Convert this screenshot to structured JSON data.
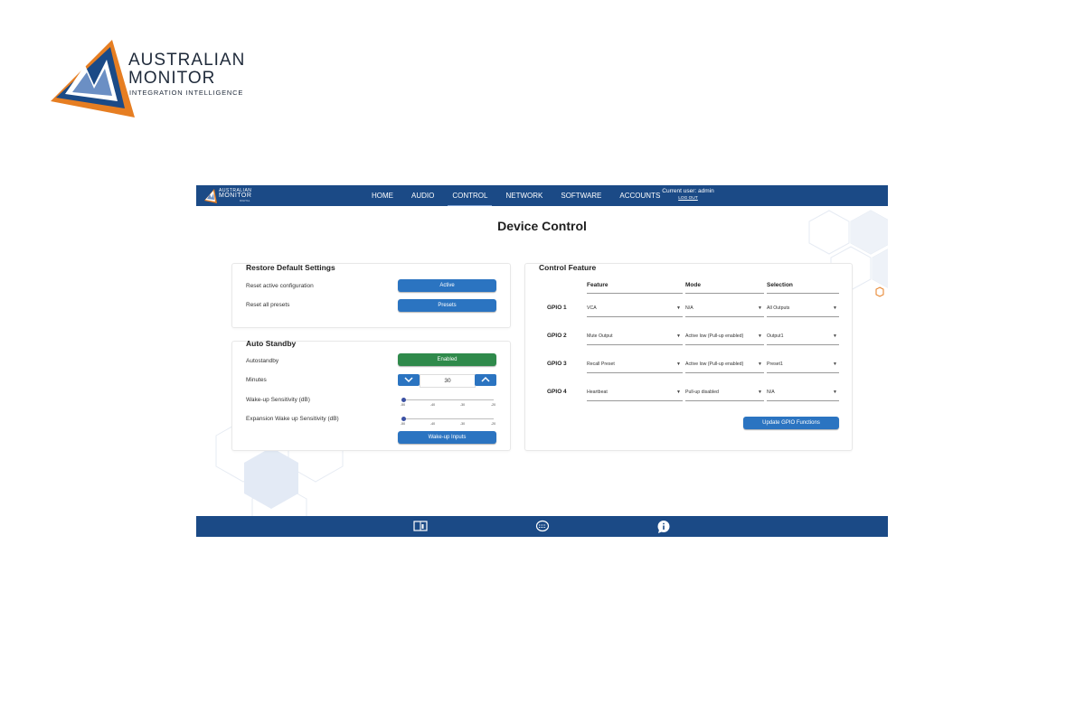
{
  "logo": {
    "line1": "AUSTRALIAN",
    "line2": "MONITOR",
    "line3": "INTEGRATION INTELLIGENCE"
  },
  "mini_logo": {
    "line1": "AUSTRALIAN",
    "line2": "MONITOR",
    "line3": "DIGITAL"
  },
  "nav": {
    "items": [
      "HOME",
      "AUDIO",
      "CONTROL",
      "NETWORK",
      "SOFTWARE",
      "ACCOUNTS"
    ],
    "active": "CONTROL"
  },
  "user": {
    "current": "Current user: admin",
    "logout": "LOG OUT"
  },
  "page_title": "Device Control",
  "restore": {
    "title": "Restore Default Settings",
    "rows": [
      {
        "label": "Reset active configuration",
        "button": "Active"
      },
      {
        "label": "Reset all presets",
        "button": "Presets"
      }
    ]
  },
  "standby": {
    "title": "Auto Standby",
    "autostandby_label": "Autostandby",
    "autostandby_button": "Enabled",
    "minutes_label": "Minutes",
    "minutes_value": "30",
    "wake_label": "Wake-up Sensitivity (dB)",
    "exp_wake_label": "Expansion Wake up Sensitivity (dB)",
    "slider_ticks": [
      "-50",
      "-40",
      "-30",
      "-20"
    ],
    "wake_value": -50,
    "exp_wake_value": -50,
    "wake_inputs_button": "Wake-up Inputs"
  },
  "control": {
    "title": "Control Feature",
    "headers": {
      "feature": "Feature",
      "mode": "Mode",
      "selection": "Selection"
    },
    "rows": [
      {
        "gpio": "GPIO 1",
        "feature": "VCA",
        "mode": "N/A",
        "selection": "All Outputs"
      },
      {
        "gpio": "GPIO 2",
        "feature": "Mute Output",
        "mode": "Active low (Pull-up enabled)",
        "selection": "Output1"
      },
      {
        "gpio": "GPIO 3",
        "feature": "Recall Preset",
        "mode": "Active low (Pull-up enabled)",
        "selection": "Preset1"
      },
      {
        "gpio": "GPIO 4",
        "feature": "Heartbeat",
        "mode": "Pull-up disabled",
        "selection": "N/A"
      }
    ],
    "update_button": "Update GPIO Functions"
  },
  "footer_icons": [
    "manual-icon",
    "keyboard-icon",
    "info-chat-icon"
  ],
  "colors": {
    "bar": "#1b4a86",
    "button": "#2b74c1",
    "enabled": "#2f8a4b",
    "logo_orange": "#e67e22"
  }
}
